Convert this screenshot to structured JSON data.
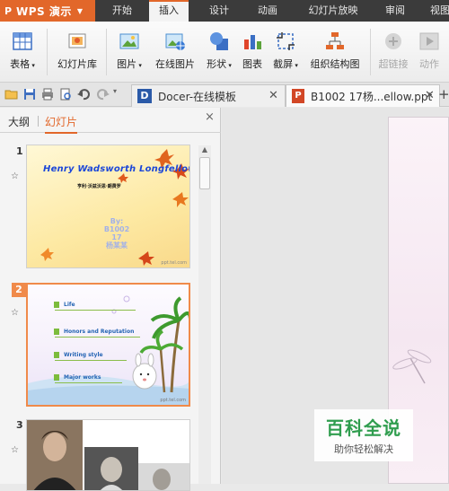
{
  "app": {
    "icon_letter": "P",
    "title": "WPS 演示"
  },
  "menu": {
    "tabs": [
      "开始",
      "插入",
      "设计",
      "动画",
      "幻灯片放映",
      "审阅",
      "视图"
    ],
    "active_index": 1
  },
  "ribbon": {
    "table": "表格",
    "slide_library": "幻灯片库",
    "picture": "图片",
    "online_picture": "在线图片",
    "shapes": "形状",
    "chart": "图表",
    "screenshot": "截屏",
    "org_chart": "组织结构图",
    "hyperlink": "超链接",
    "action": "动作"
  },
  "tabs": {
    "docer": {
      "label": "Docer-在线模板"
    },
    "ppt": {
      "label": "B1002 17杨...ellow.ppt"
    },
    "add": "+"
  },
  "panel": {
    "outline_tab": "大纲",
    "slides_tab": "幻灯片",
    "close": "×"
  },
  "slides": [
    {
      "number": "1",
      "title": "Henry Wadsworth Longfellow",
      "subtitle": "亨利·沃兹沃思·朗费罗",
      "byline_1": "By:",
      "byline_2": "B1002",
      "byline_3": "17",
      "byline_4": "杨某某",
      "footer": "ppt.tel.com"
    },
    {
      "number": "2",
      "items": [
        "Life",
        "Honors and Reputation",
        "Writing style",
        "Major works"
      ],
      "footer": "ppt.tel.com"
    },
    {
      "number": "3"
    }
  ],
  "watermark": {
    "title": "百科全说",
    "subtitle": "助你轻松解决"
  },
  "colors": {
    "accent": "#e2672a",
    "title_blue": "#1c47d8",
    "menu_bg": "#3b3b3b"
  }
}
